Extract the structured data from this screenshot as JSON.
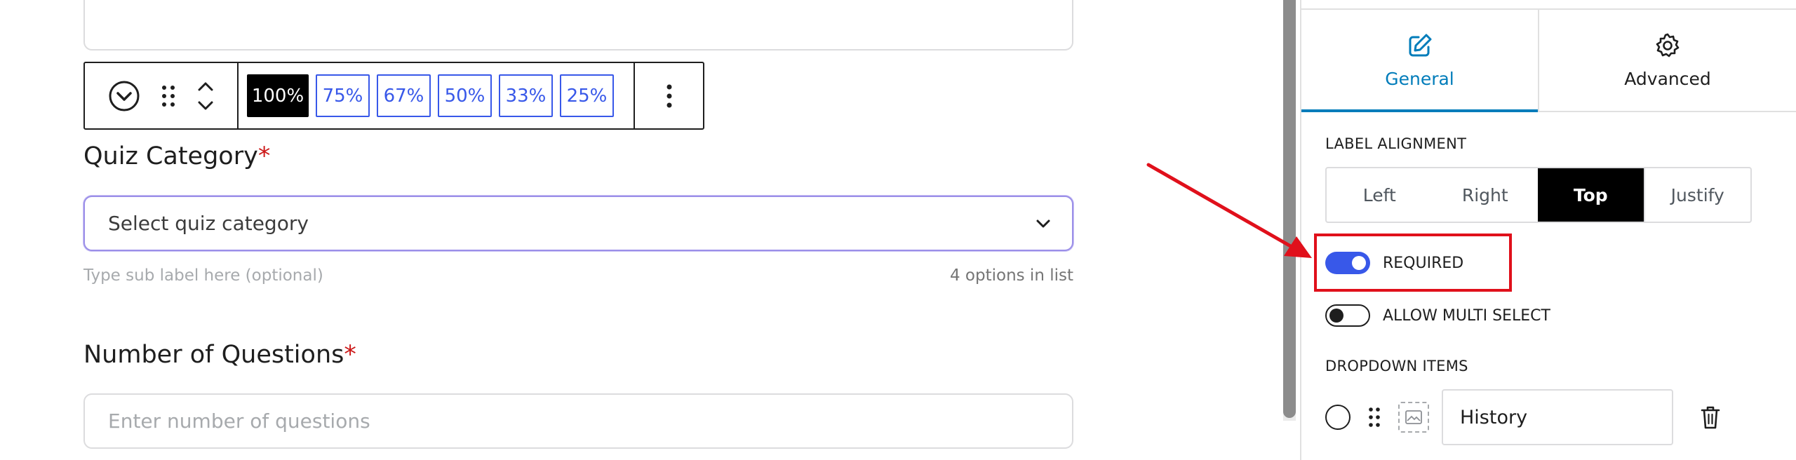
{
  "toolbar": {
    "width_options": [
      "100%",
      "75%",
      "67%",
      "50%",
      "33%",
      "25%"
    ],
    "active_width": "100%"
  },
  "fields": {
    "quiz_category": {
      "label": "Quiz Category",
      "required_mark": "*",
      "placeholder": "Select quiz category",
      "sub_label_placeholder": "Type sub label here (optional)",
      "options_count": "4 options in list"
    },
    "num_questions": {
      "label": "Number of Questions",
      "required_mark": "*",
      "placeholder": "Enter number of questions"
    }
  },
  "sidebar": {
    "tabs": [
      {
        "label": "General",
        "icon": "edit-icon",
        "active": true
      },
      {
        "label": "Advanced",
        "icon": "gear-icon",
        "active": false
      }
    ],
    "label_alignment": {
      "title": "LABEL ALIGNMENT",
      "options": [
        "Left",
        "Right",
        "Top",
        "Justify"
      ],
      "selected": "Top"
    },
    "required_toggle": {
      "label": "REQUIRED",
      "on": true
    },
    "multi_select_toggle": {
      "label": "ALLOW MULTI SELECT",
      "on": false
    },
    "dropdown_items": {
      "title": "DROPDOWN ITEMS",
      "items": [
        {
          "value": "History"
        }
      ]
    }
  },
  "colors": {
    "accent": "#3858e9",
    "tab_active": "#007cba",
    "annotation": "#e0101b",
    "required_star": "#cc1818"
  }
}
